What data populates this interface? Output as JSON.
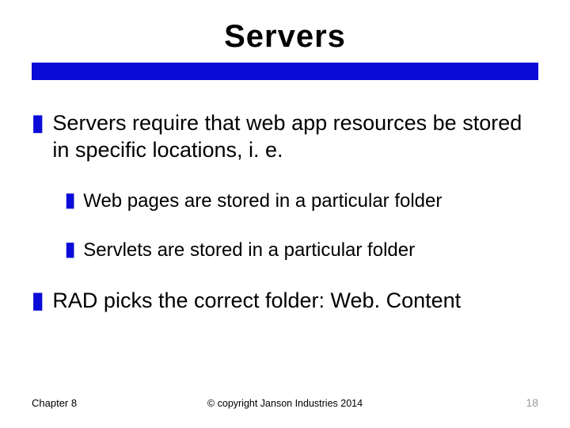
{
  "title": "Servers",
  "colors": {
    "accent": "#0b0bd8"
  },
  "bullets": [
    {
      "level": 1,
      "text": "Servers require that web app resources be stored in specific locations, i. e.",
      "children": [
        {
          "level": 2,
          "text": "Web pages are stored in a particular folder"
        },
        {
          "level": 2,
          "text": "Servlets are stored in a particular folder"
        }
      ]
    },
    {
      "level": 1,
      "text": "RAD picks the correct folder: Web. Content",
      "children": []
    }
  ],
  "footer": {
    "left": "Chapter 8",
    "center": "© copyright Janson Industries 2014",
    "right": "18"
  }
}
